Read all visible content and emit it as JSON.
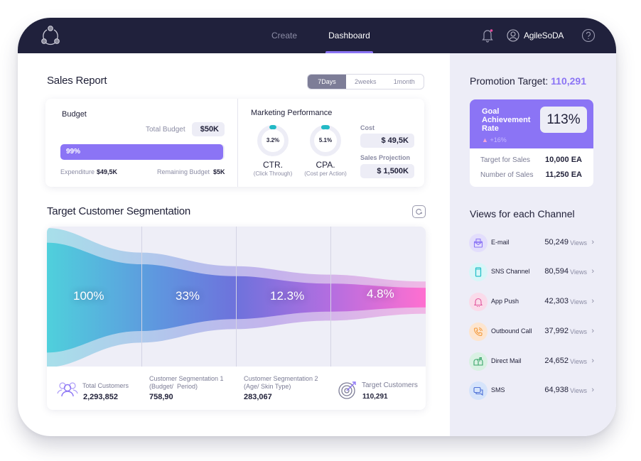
{
  "nav": {
    "items": [
      {
        "label": "Create",
        "active": false
      },
      {
        "label": "Dashboard",
        "active": true
      }
    ],
    "user_name": "AgileSoDA",
    "notification_dot_color": "#e74a9d"
  },
  "sales_report": {
    "title": "Sales Report",
    "periods": [
      "7Days",
      "2weeks",
      "1month"
    ],
    "active_period": "7Days",
    "budget": {
      "title": "Budget",
      "total_label": "Total Budget",
      "total_value": "$50K",
      "progress_label": "99%",
      "progress_fraction": 0.99,
      "expenditure_label": "Expenditure",
      "expenditure_value": "$49,5K",
      "remaining_label": "Remaining Budget",
      "remaining_value": "$5K"
    },
    "marketing": {
      "title": "Marketing Performance",
      "ctr": {
        "value": "3.2%",
        "name": "CTR.",
        "sub": "(Click Through)",
        "fraction": 0.032
      },
      "cpa": {
        "value": "5.1%",
        "name": "CPA.",
        "sub": "(Cost per Action)",
        "fraction": 0.051
      },
      "cost_label": "Cost",
      "cost_value": "$ 49,5K",
      "projection_label": "Sales Projection",
      "projection_value": "$ 1,500K"
    }
  },
  "segmentation": {
    "title": "Target Customer Segmentation",
    "stages": [
      {
        "percent": "100%",
        "label": "Total Customers",
        "value": "2,293,852"
      },
      {
        "percent": "33%",
        "label": "Customer Segmentation 1\n(Budget/  Period)",
        "value": "758,90"
      },
      {
        "percent": "12.3%",
        "label": "Customer Segmentation 2\n(Age/ Skin Type)",
        "value": "283,067"
      },
      {
        "percent": "4.8%",
        "label": "Target Customers",
        "value": "110,291"
      }
    ]
  },
  "promotion": {
    "title_prefix": "Promotion Target:",
    "title_value": "110,291",
    "goal_label": "Goal\nAchievement\nRate",
    "goal_rate": "113%",
    "goal_delta": "+16%",
    "rows": [
      {
        "label": "Target for Sales",
        "value": "10,000 EA"
      },
      {
        "label": "Number of Sales",
        "value": "11,250 EA"
      }
    ]
  },
  "channels": {
    "title": "Views for each Channel",
    "views_suffix": "Views",
    "items": [
      {
        "name": "E-mail",
        "value": "50,249",
        "icon": "email-icon",
        "bg": "#e3defc",
        "fg": "#8b74f5"
      },
      {
        "name": "SNS Channel",
        "value": "80,594",
        "icon": "mobile-icon",
        "bg": "#d8f6f8",
        "fg": "#27c1c9"
      },
      {
        "name": "App Push",
        "value": "42,303",
        "icon": "bell-icon",
        "bg": "#fadbea",
        "fg": "#e0529b"
      },
      {
        "name": "Outbound Call",
        "value": "37,992",
        "icon": "phone-icon",
        "bg": "#fde5cf",
        "fg": "#f39a3c"
      },
      {
        "name": "Direct Mail",
        "value": "24,652",
        "icon": "mailbox-icon",
        "bg": "#d9f1e3",
        "fg": "#3aa56a"
      },
      {
        "name": "SMS",
        "value": "64,938",
        "icon": "chat-icon",
        "bg": "#d6e4fb",
        "fg": "#4b6fd6"
      }
    ]
  }
}
